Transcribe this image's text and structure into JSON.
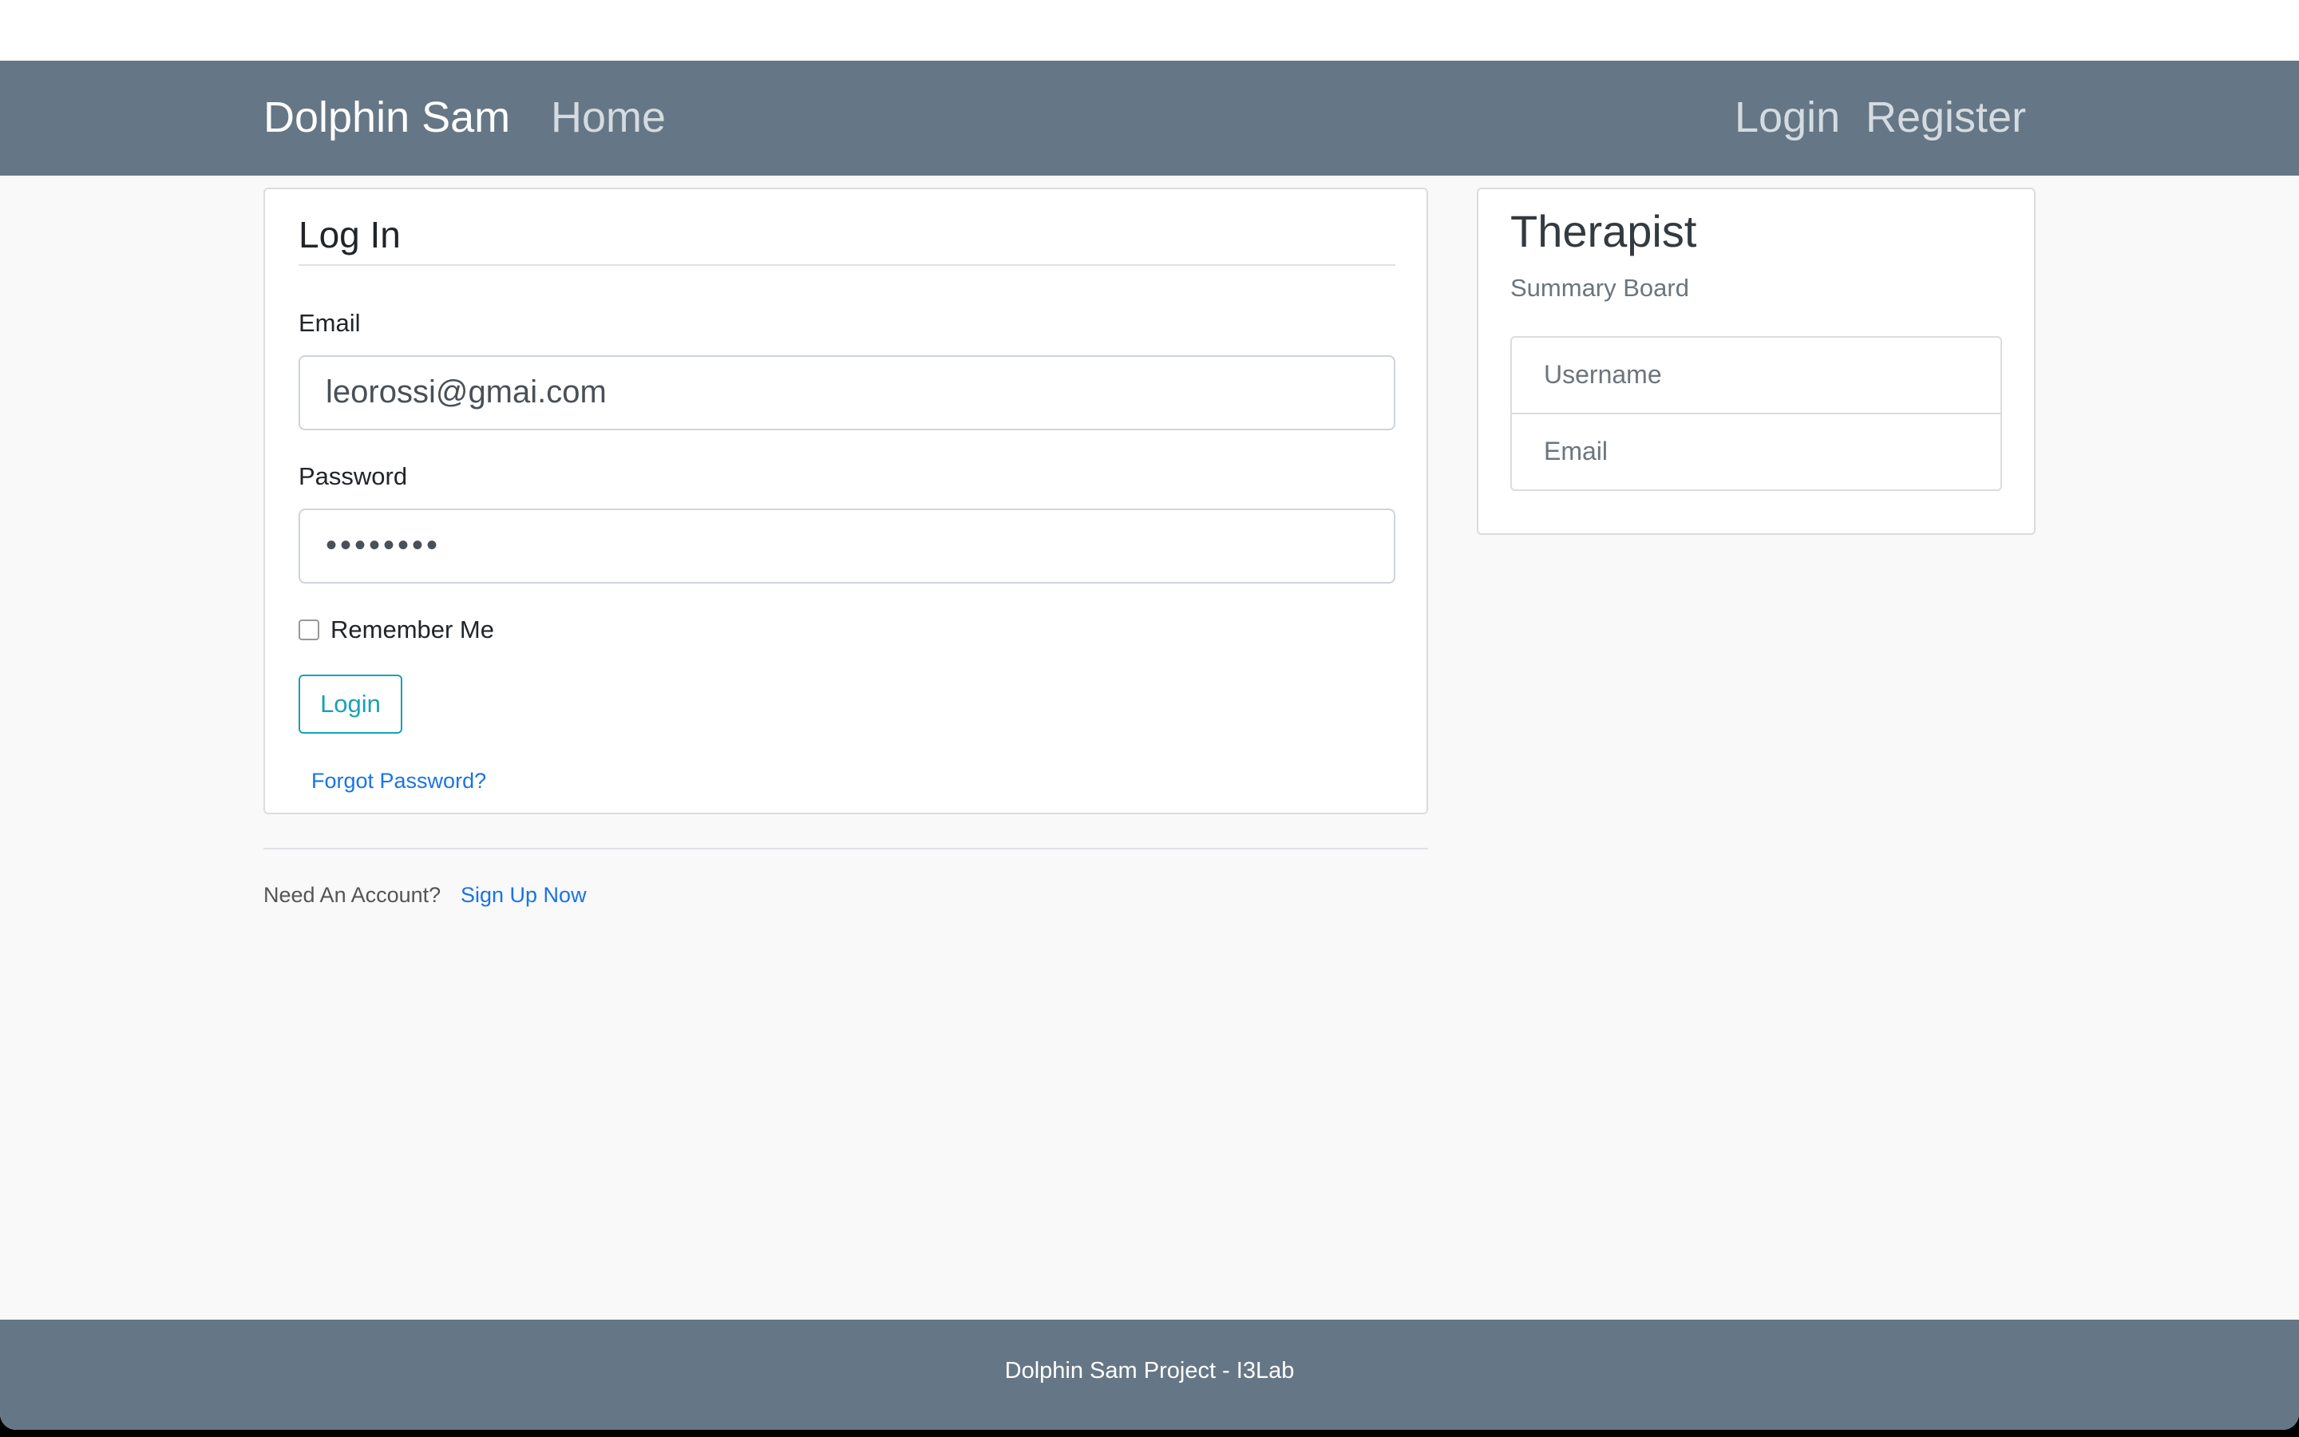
{
  "nav": {
    "brand": "Dolphin Sam",
    "home": "Home",
    "login": "Login",
    "register": "Register"
  },
  "login_card": {
    "title": "Log In",
    "email_label": "Email",
    "email_value": "leorossi@gmai.com",
    "password_label": "Password",
    "password_value": "••••••••",
    "remember_label": "Remember Me",
    "remember_checked": false,
    "login_button": "Login",
    "forgot": "Forgot Password?"
  },
  "signup": {
    "prompt": "Need An Account?",
    "link": "Sign Up Now"
  },
  "side_card": {
    "title": "Therapist",
    "subtitle": "Summary Board",
    "items": [
      "Username",
      "Email"
    ]
  },
  "footer": {
    "text": "Dolphin Sam Project - I3Lab"
  },
  "colors": {
    "navbar": "#657786",
    "link": "#1a73e8",
    "button": "#17a2b8"
  }
}
